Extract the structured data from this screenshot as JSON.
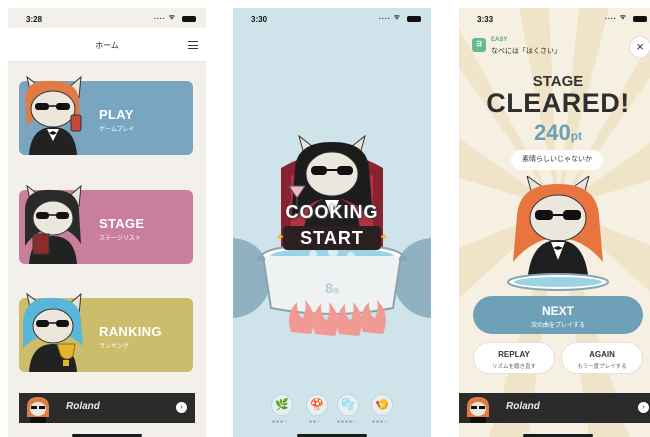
{
  "screen1": {
    "time": "3:28",
    "signal": "....",
    "header_title": "ホーム",
    "menu": [
      {
        "label": "PLAY",
        "sub": "ゲームプレイ",
        "color": "#7aa5c1"
      },
      {
        "label": "STAGE",
        "sub": "ステージリスト",
        "color": "#c97f9b"
      },
      {
        "label": "RANKING",
        "sub": "ランキング",
        "color": "#cbbd6c"
      }
    ],
    "banner_brand": "Roland",
    "banner_arrow": "›"
  },
  "screen2": {
    "time": "3:30",
    "signal": "....",
    "title_line1": "COOKING",
    "title_line2": "START",
    "counter": "8",
    "counter_unit": "/8",
    "ingredients": [
      {
        "icon": "🌿",
        "dots": "●●●–"
      },
      {
        "icon": "🍄",
        "dots": "●●–"
      },
      {
        "icon": "🫧",
        "dots": "●●●●–"
      },
      {
        "icon": "🍤",
        "dots": "●●●–"
      }
    ]
  },
  "screen3": {
    "time": "3:33",
    "signal": "....",
    "badge": "ヨ",
    "difficulty": "EASY",
    "song": "なべには「はくさい」",
    "close": "×",
    "stage_label": "STAGE",
    "cleared_label": "CLEARED!",
    "points": "240",
    "points_unit": "pt",
    "praise": "素晴らしいじゃないか",
    "next": {
      "label": "NEXT",
      "sub": "次の曲をプレイする"
    },
    "replay": {
      "label": "REPLAY",
      "sub": "リズムを聴き直す"
    },
    "again": {
      "label": "AGAIN",
      "sub": "もう一度プレイする"
    },
    "banner_brand": "Roland",
    "banner_arrow": "›"
  }
}
